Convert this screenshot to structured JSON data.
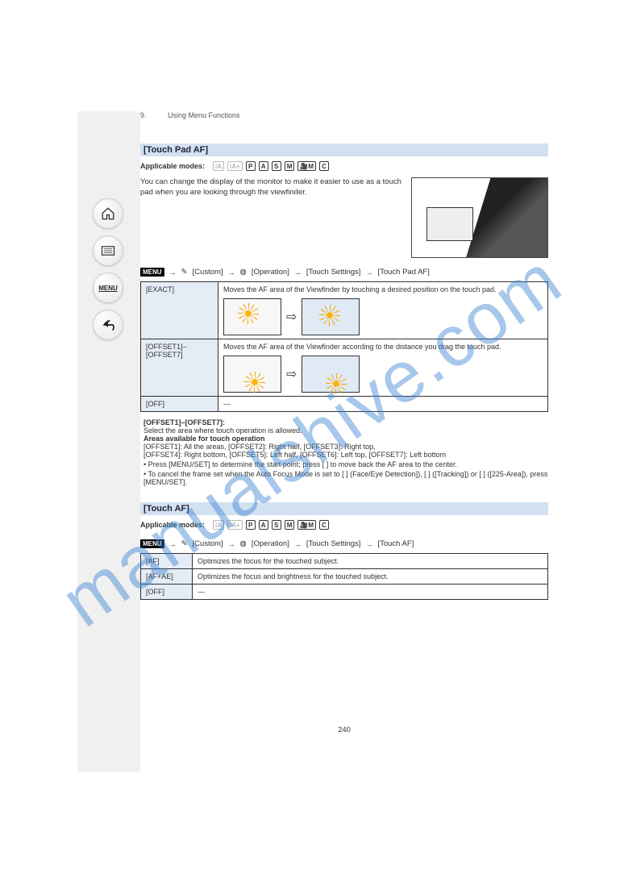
{
  "watermark": "manualshive.com",
  "chapter": {
    "num": "9.",
    "title": "Using Menu Functions"
  },
  "nav": {
    "home": "home-icon",
    "list": "list-icon",
    "menu_label": "MENU",
    "back": "back-icon"
  },
  "section1": {
    "title": "[Touch Pad AF]",
    "mode_label": "Applicable modes:",
    "modes": [
      "iA",
      "iA+",
      "P",
      "A",
      "S",
      "M",
      "🎥M",
      "C"
    ],
    "desc": "You can change the display of the monitor to make it easier to use as a touch pad when you are looking through the viewfinder.",
    "menu_path": {
      "menu_badge": "MENU",
      "custom": "[Custom]",
      "operation": "[Operation]",
      "touch_settings": "[Touch Settings]",
      "touch_pad_af": "[Touch Pad AF]"
    },
    "rows": [
      {
        "key": "[EXACT]",
        "val": "Moves the AF area of the Viewfinder by touching a desired position on the touch pad."
      },
      {
        "key": "[OFFSET1]–\n[OFFSET7]",
        "val": "Moves the AF area of the Viewfinder according to the distance you drag the touch pad."
      },
      {
        "key": "[OFF]",
        "val": "—"
      }
    ],
    "offset_label": "[OFFSET1]–[OFFSET7]:",
    "offset_desc": "Select the area where touch operation is allowed.",
    "offset_caption": "Areas available for touch operation",
    "offset_items": [
      "[OFFSET1]: All the areas, [OFFSET2]: Right half, [OFFSET3]: Right top,",
      "[OFFSET4]: Right bottom, [OFFSET5]: Left half, [OFFSET6]: Left top, [OFFSET7]: Left bottom"
    ],
    "bullets": [
      "Press [MENU/SET] to determine the start point; press [     ] to move back the AF area to the center.",
      "To cancel the frame set when the Auto Focus Mode is set to [   ] (Face/Eye Detection]), [   ] ([Tracking]) or [   ] ([225-Area]), press [MENU/SET]."
    ]
  },
  "section2": {
    "title": "[Touch AF]",
    "mode_label": "Applicable modes:",
    "modes": [
      "iA",
      "iA+",
      "P",
      "A",
      "S",
      "M",
      "🎥M",
      "C"
    ],
    "menu_path": {
      "menu_badge": "MENU",
      "custom": "[Custom]",
      "operation": "[Operation]",
      "touch_settings": "[Touch Settings]",
      "touch_af": "[Touch AF]"
    },
    "rows": [
      {
        "key": "[AF]",
        "val": "Optimizes the focus for the touched subject."
      },
      {
        "key": "[AF+AE]",
        "val": "Optimizes the focus and brightness for the touched subject."
      },
      {
        "key": "[OFF]",
        "val": "—"
      }
    ]
  },
  "page_number": "240"
}
